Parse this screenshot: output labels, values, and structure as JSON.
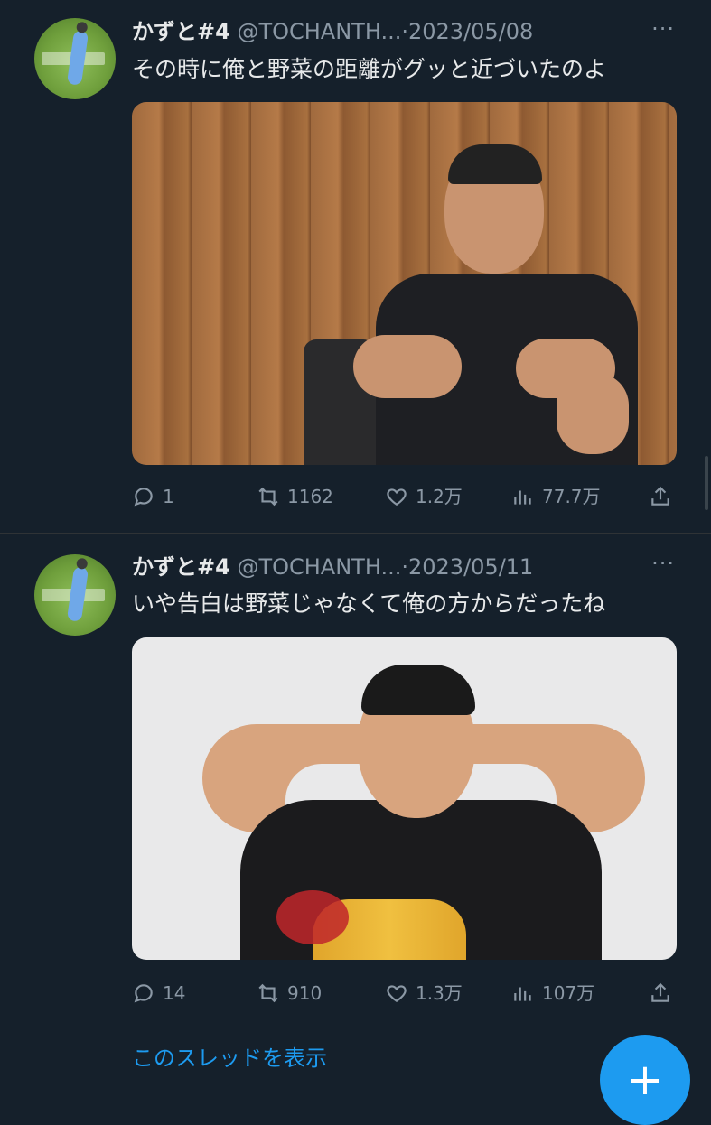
{
  "tweets": [
    {
      "name": "かずと#4",
      "handle": "@TOCHANTH...",
      "separator": "·",
      "date": "2023/05/08",
      "more": "···",
      "text": "その時に俺と野菜の距離がグッと近づいたのよ",
      "stats": {
        "replies": "1",
        "retweets": "1162",
        "likes": "1.2万",
        "views": "77.7万"
      }
    },
    {
      "name": "かずと#4",
      "handle": "@TOCHANTH...",
      "separator": "·",
      "date": "2023/05/11",
      "more": "···",
      "text": "いや告白は野菜じゃなくて俺の方からだったね",
      "stats": {
        "replies": "14",
        "retweets": "910",
        "likes": "1.3万",
        "views": "107万"
      }
    }
  ],
  "show_thread": "このスレッドを表示",
  "fab_icon": "+",
  "colors": {
    "background": "#15202b",
    "link": "#1d9bf0",
    "muted": "#8b98a5"
  }
}
